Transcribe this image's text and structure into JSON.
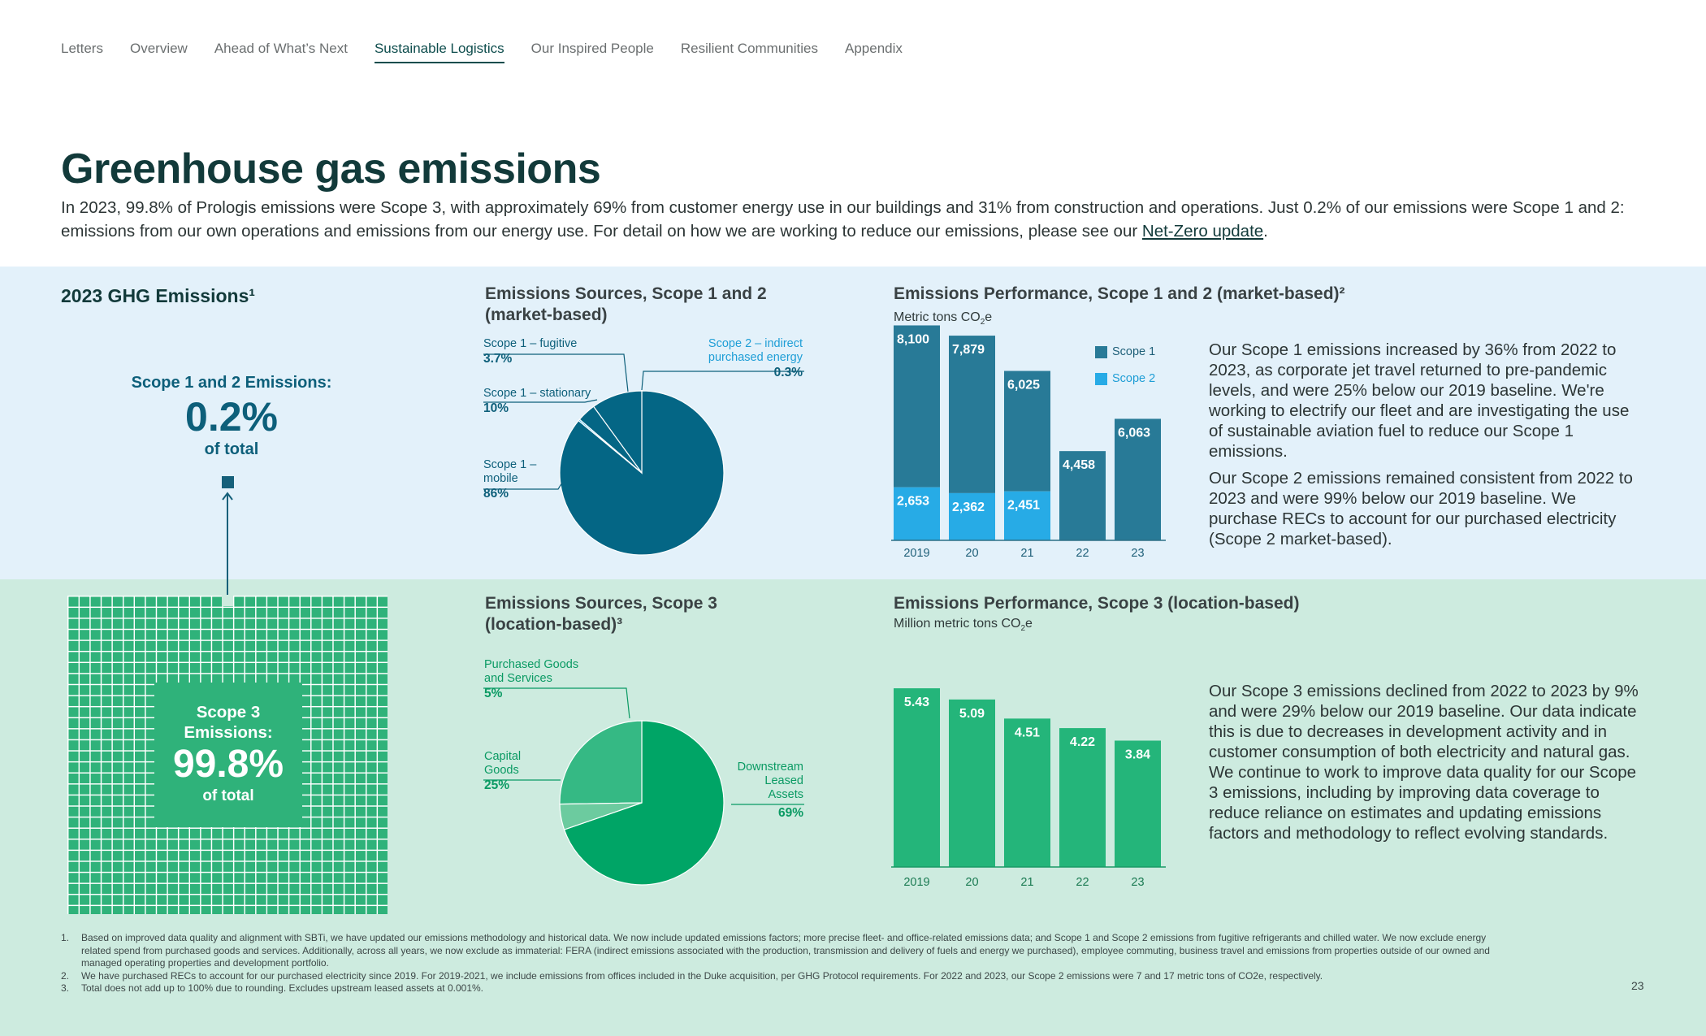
{
  "nav": {
    "items": [
      "Letters",
      "Overview",
      "Ahead of What’s Next",
      "Sustainable Logistics",
      "Our Inspired People",
      "Resilient Communities",
      "Appendix"
    ],
    "active": "Sustainable Logistics"
  },
  "page": {
    "title": "Greenhouse gas emissions",
    "intro": "In 2023, 99.8% of Prologis emissions were Scope 3, with approximately 69% from customer energy use in our buildings and 31% from construction and operations. Just 0.2% of our emissions were Scope 1 and 2: emissions from our own operations and emissions from our energy use. For detail on how we are working to reduce our emissions, please see our",
    "intro_link": "Net-Zero update",
    "intro_end": ".",
    "page_number": "23"
  },
  "ghg": {
    "heading": "2023 GHG Emissions¹",
    "scope12_label": "Scope 1 and 2 Emissions:",
    "scope12_value": "0.2%",
    "scope12_suffix": "of total",
    "scope3_label": "Scope 3 Emissions:",
    "scope3_value": "99.8%",
    "scope3_suffix": "of total"
  },
  "pie12": {
    "heading_line1": "Emissions Sources, Scope 1 and 2",
    "heading_line2": "(market-based)",
    "labels": {
      "fugitive": {
        "name": "Scope 1 – fugitive",
        "pct": "3.7%"
      },
      "stationary": {
        "name": "Scope 1 – stationary",
        "pct": "10%"
      },
      "mobile_line1": "Scope 1 –",
      "mobile_line2": "mobile",
      "mobile_pct": "86%",
      "indirect_line1": "Scope 2 – indirect",
      "indirect_line2": "purchased energy",
      "indirect_pct": "0.3%"
    }
  },
  "pie3": {
    "heading_line1": "Emissions Sources, Scope 3",
    "heading_line2": "(location-based)³",
    "labels": {
      "goods_line1": "Purchased Goods",
      "goods_line2": "and Services",
      "goods_pct": "5%",
      "capital_line1": "Capital",
      "capital_line2": "Goods",
      "capital_pct": "25%",
      "down_line1": "Downstream",
      "down_line2": "Leased",
      "down_line3": "Assets",
      "down_pct": "69%"
    }
  },
  "perf12": {
    "heading": "Emissions Performance, Scope 1 and 2 (market-based)²",
    "subtitle": "Metric tons CO",
    "subtitle_sub": "2",
    "subtitle_end": "e",
    "legend_scope1": "Scope 1",
    "legend_scope2": "Scope 2",
    "text1": "Our Scope 1 emissions increased by 36% from 2022 to 2023, as corporate jet travel returned to pre-pandemic levels, and were 25% below our 2019 baseline. We're working to electrify our fleet and are investigating the use of sustainable aviation fuel to reduce our Scope 1 emissions.",
    "text2": "Our Scope 2 emissions remained consistent from 2022 to 2023 and were 99% below our 2019 baseline. We purchase RECs to account for our purchased electricity (Scope 2 market-based)."
  },
  "perf3": {
    "heading": "Emissions Performance, Scope 3 (location-based)",
    "subtitle": "Million metric tons CO",
    "subtitle_sub": "2",
    "subtitle_end": "e",
    "text": "Our Scope 3 emissions declined from 2022 to 2023 by 9% and were 29% below our 2019 baseline. Our data indicate this is due to decreases in development activity and in customer consumption of both electricity and natural gas. We continue to work to improve data quality for our Scope 3 emissions, including by improving data coverage to reduce reliance on estimates and updating emissions factors and methodology to reflect evolving standards."
  },
  "footnotes": [
    {
      "num": "1.",
      "text": "Based on improved data quality and alignment with SBTi, we have updated our emissions methodology and historical data. We now include updated emissions factors; more precise fleet- and office-related emissions data; and Scope 1 and Scope 2 emissions from fugitive refrigerants and chilled water. We now exclude energy related spend from purchased goods and services. Additionally, across all years, we now exclude as immaterial: FERA (indirect emissions associated with the production, transmission and delivery of fuels and energy we purchased), employee commuting, business travel and emissions from properties outside of our owned and managed operating properties and development portfolio."
    },
    {
      "num": "2.",
      "text": "We have purchased RECs to account for our purchased electricity since 2019. For 2019-2021, we include emissions from offices included in the Duke acquisition, per GHG Protocol requirements. For 2022 and 2023, our Scope 2 emissions were 7 and 17 metric tons of CO2e, respectively."
    },
    {
      "num": "3.",
      "text": "Total does not add up to 100% due to rounding. Excludes upstream leased assets at 0.001%."
    }
  ],
  "colors": {
    "scope1": "#287a97",
    "scope2": "#27abe6",
    "scope3_bar": "#24b57a",
    "pie12_main": "#046685",
    "pie3_main": "#00a566",
    "pie3_capital": "#35b984",
    "pie3_goods": "#6ccb9f"
  },
  "chart_data": [
    {
      "type": "pie",
      "title": "Emissions Sources, Scope 1 and 2 (market-based)",
      "labels": [
        "Scope 1 – mobile",
        "Scope 1 – stationary",
        "Scope 1 – fugitive",
        "Scope 2 – indirect purchased energy"
      ],
      "values": [
        86,
        10,
        3.7,
        0.3
      ]
    },
    {
      "type": "pie",
      "title": "Emissions Sources, Scope 3 (location-based)",
      "labels": [
        "Downstream Leased Assets",
        "Capital Goods",
        "Purchased Goods and Services"
      ],
      "values": [
        69,
        25,
        5
      ]
    },
    {
      "type": "bar",
      "title": "Emissions Performance, Scope 1 and 2 (market-based)",
      "ylabel": "Metric tons CO2e",
      "categories": [
        "2019",
        "20",
        "21",
        "22",
        "23"
      ],
      "stacked": true,
      "series": [
        {
          "name": "Scope 1",
          "values": [
            8100,
            7879,
            6025,
            4458,
            6063
          ]
        },
        {
          "name": "Scope 2",
          "values": [
            2653,
            2362,
            2451,
            7,
            17
          ]
        }
      ]
    },
    {
      "type": "bar",
      "title": "Emissions Performance, Scope 3 (location-based)",
      "ylabel": "Million metric tons CO2e",
      "categories": [
        "2019",
        "20",
        "21",
        "22",
        "23"
      ],
      "values": [
        5.43,
        5.09,
        4.51,
        4.22,
        3.84
      ]
    }
  ]
}
